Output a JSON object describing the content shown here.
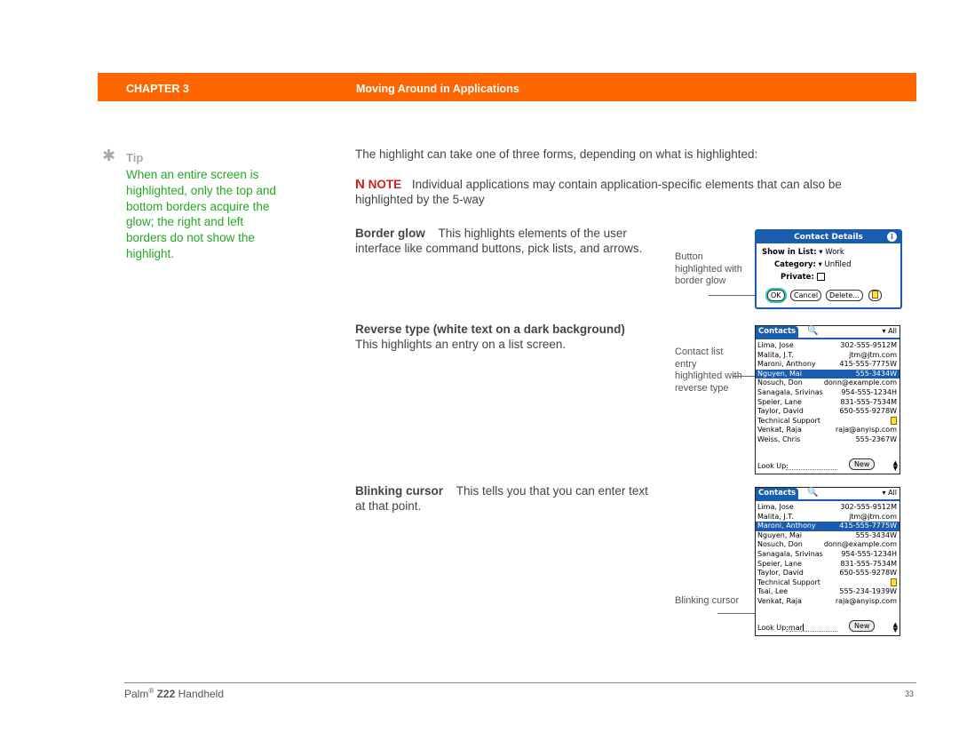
{
  "header": {
    "chapter": "CHAPTER 3",
    "title": "Moving Around in Applications",
    "bar_color": "#ff6600"
  },
  "tip": {
    "icon": "asterisk-icon",
    "label": "Tip",
    "text": "When an entire screen is highlighted, only the top and bottom borders acquire the glow; the right and left borders do not show the highlight.",
    "color": "#22aa22"
  },
  "intro": "The highlight can take one of three forms, depending on what is highlighted:",
  "note": {
    "icon": "note-icon",
    "label": "NOTE",
    "text": "Individual applications may contain application-specific elements that can also be highlighted by the 5-way"
  },
  "sections": [
    {
      "term": "Border glow",
      "text": "This highlights elements of the user interface like command buttons, pick lists, and arrows.",
      "caption": "Button highlighted with border glow"
    },
    {
      "term": "Reverse type (white text on a dark background)",
      "text": "This highlights an entry on a list screen.",
      "caption": "Contact list entry highlighted with reverse type"
    },
    {
      "term": "Blinking cursor",
      "text": "This tells you that you can enter text at that point.",
      "caption": "Blinking cursor"
    }
  ],
  "dialog": {
    "title": "Contact Details",
    "show_label": "Show in List:",
    "show_value": "Work",
    "category_label": "Category:",
    "category_value": "Unfiled",
    "private_label": "Private:",
    "buttons": {
      "ok": "OK",
      "cancel": "Cancel",
      "delete": "Delete..."
    }
  },
  "list1": {
    "title": "Contacts",
    "category": "All",
    "rows": [
      {
        "name": "Lima, Jose",
        "value": "302-555-9512M"
      },
      {
        "name": "Malita, J.T.",
        "value": "jtm@jtm.com"
      },
      {
        "name": "Maroni, Anthony",
        "value": "415-555-7775W"
      },
      {
        "name": "Nguyen, Mai",
        "value": "555-3434W"
      },
      {
        "name": "Nosuch, Don",
        "value": "donn@example.com"
      },
      {
        "name": "Sanagala, Srivinas",
        "value": "954-555-1234H"
      },
      {
        "name": "Speier, Lane",
        "value": "831-555-7534M"
      },
      {
        "name": "Taylor, David",
        "value": "650-555-9278W"
      },
      {
        "name": "Technical Support",
        "value": ""
      },
      {
        "name": "Venkat, Raja",
        "value": "raja@anyisp.com"
      },
      {
        "name": "Weiss, Chris",
        "value": "555-2367W"
      }
    ],
    "selected_index": 3,
    "lookup_label": "Look Up:",
    "lookup_value": "",
    "new_button": "New"
  },
  "list2": {
    "title": "Contacts",
    "category": "All",
    "rows": [
      {
        "name": "Lima, Jose",
        "value": "302-555-9512M"
      },
      {
        "name": "Malita, J.T.",
        "value": "jtm@jtm.com"
      },
      {
        "name": "Maroni, Anthony",
        "value": "415-555-7775W"
      },
      {
        "name": "Nguyen, Mai",
        "value": "555-3434W"
      },
      {
        "name": "Nosuch, Don",
        "value": "donn@example.com"
      },
      {
        "name": "Sanagala, Srivinas",
        "value": "954-555-1234H"
      },
      {
        "name": "Speier, Lane",
        "value": "831-555-7534M"
      },
      {
        "name": "Taylor, David",
        "value": "650-555-9278W"
      },
      {
        "name": "Technical Support",
        "value": ""
      },
      {
        "name": "Tsai, Lee",
        "value": "555-234-1939W"
      },
      {
        "name": "Venkat, Raja",
        "value": "raja@anyisp.com"
      }
    ],
    "selected_index": 2,
    "lookup_label": "Look Up:",
    "lookup_value": "mar",
    "new_button": "New"
  },
  "footer": {
    "brand": "Palm",
    "reg": "®",
    "model": "Z22",
    "product": "Handheld",
    "page": "33"
  }
}
